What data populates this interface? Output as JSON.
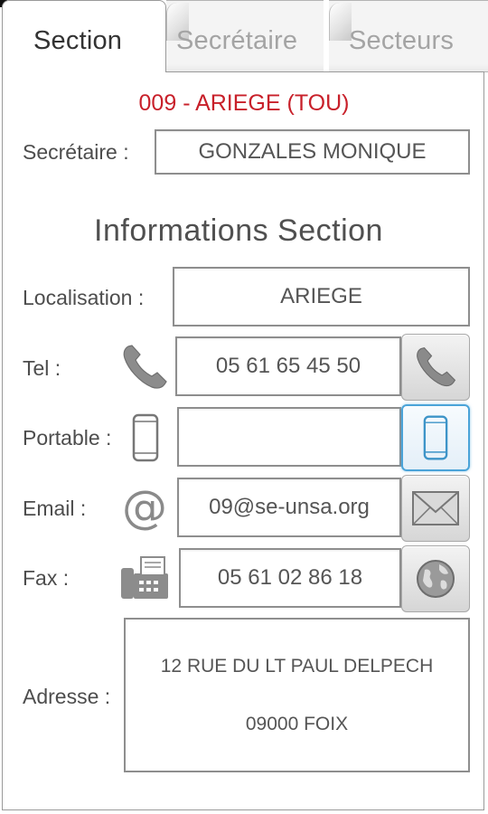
{
  "tabs": [
    {
      "label": "Section",
      "active": true
    },
    {
      "label": "Secrétaire",
      "active": false
    },
    {
      "label": "Secteurs",
      "active": false
    }
  ],
  "section": {
    "name": "009 - ARIEGE (TOU)",
    "secretaire_label": "Secrétaire :",
    "secretaire_value": "GONZALES MONIQUE",
    "info_heading": "Informations Section"
  },
  "fields": {
    "localisation": {
      "label": "Localisation :",
      "value": "ARIEGE"
    },
    "tel": {
      "label": "Tel :",
      "value": "05 61 65 45 50",
      "icon": "phone-icon"
    },
    "portable": {
      "label": "Portable :",
      "value": "",
      "icon": "mobile-phone-icon"
    },
    "email": {
      "label": "Email :",
      "value": "09@se-unsa.org",
      "icon": "at-sign-icon"
    },
    "fax": {
      "label": "Fax :",
      "value": "05 61 02 86 18",
      "icon": "fax-icon"
    },
    "adresse": {
      "label": "Adresse :",
      "line1": "12 RUE DU LT PAUL DELPECH",
      "line2": "09000 FOIX"
    }
  },
  "actions": {
    "call": "phone-icon",
    "mobile": "mobile-phone-icon",
    "mail": "envelope-icon",
    "web": "globe-icon"
  },
  "colors": {
    "section_title": "#c8202a",
    "focus_border": "#4aa3d8"
  }
}
